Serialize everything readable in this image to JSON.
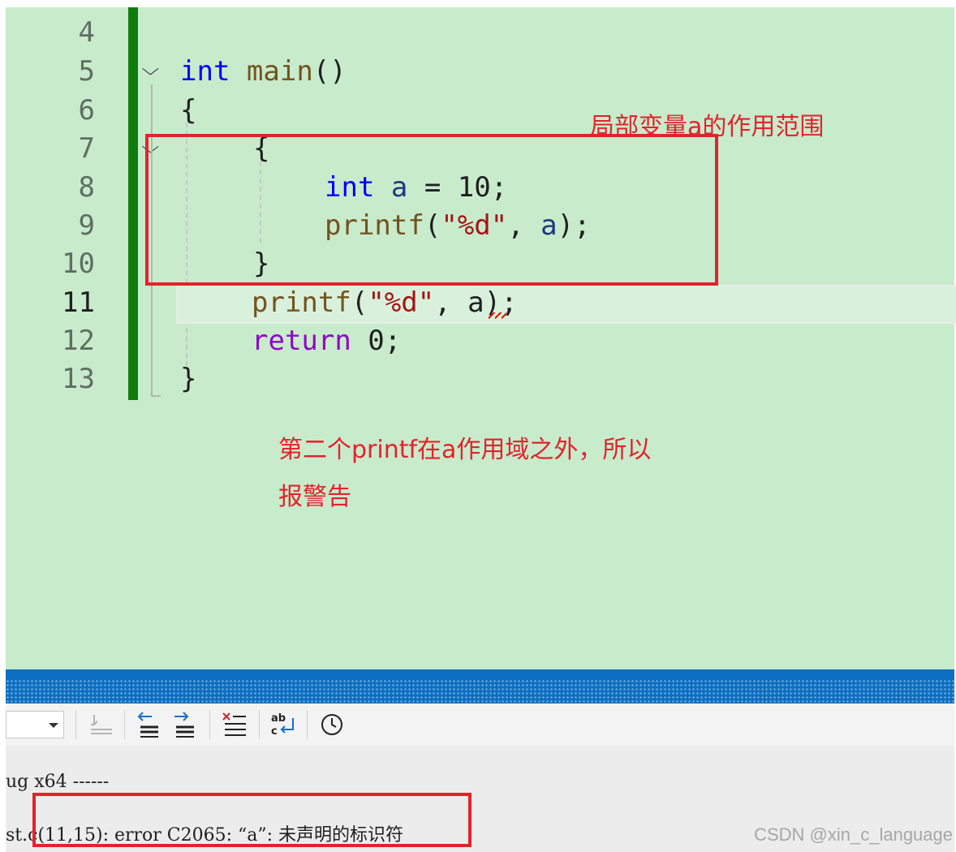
{
  "editor": {
    "line_numbers": [
      "4",
      "5",
      "6",
      "7",
      "8",
      "9",
      "10",
      "11",
      "12",
      "13"
    ],
    "current_line": "11",
    "code_lines": {
      "l5_type": "int",
      "l5_name": "main",
      "l5_parens": "()",
      "l6": "{",
      "l7": "{",
      "l8_type": "int",
      "l8_var": "a",
      "l8_rest": " = 10;",
      "l9_fn": "printf",
      "l9_open": "(",
      "l9_str": "\"%d\"",
      "l9_comma": ", ",
      "l9_var": "a",
      "l9_close": ");",
      "l10": "}",
      "l11_fn": "printf",
      "l11_open": "(",
      "l11_str": "\"%d\"",
      "l11_comma": ", ",
      "l11_var": "a",
      "l11_close": ");",
      "l12_kw": "return",
      "l12_rest": " 0;",
      "l13": "}"
    },
    "squiggle_color": "#e51400",
    "change_bar_color": "#107c10",
    "background_color": "#c8ebcc"
  },
  "annotations": {
    "scope_label": "局部变量a的作用范围",
    "warning_line1": "第二个printf在a作用域之外，所以",
    "warning_line2": "报警告",
    "color": "#e3232b"
  },
  "toolbar": {
    "icons": [
      "clear-icon",
      "prev-message-icon",
      "next-message-icon",
      "clear-all-icon",
      "word-wrap-icon",
      "clock-icon"
    ]
  },
  "output": {
    "line1": "ug x64 ------",
    "line2": "st.c(11,15): error C2065: “a”: 未声明的标识符"
  },
  "watermark": "CSDN @xin_c_language"
}
